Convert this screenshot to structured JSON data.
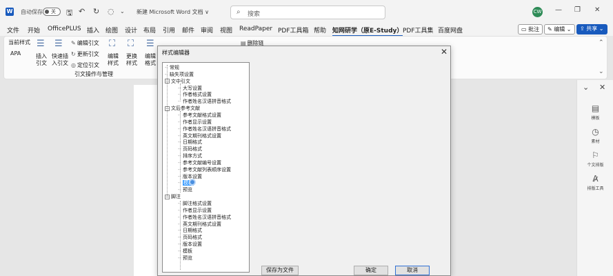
{
  "titlebar": {
    "autosave_label": "自动保存",
    "toggle_state": "关",
    "doc_title": "新建 Microsoft Word 文档 ∨",
    "search_placeholder": "搜索",
    "avatar_initials": "CW",
    "quick_access_icons": [
      "save-icon",
      "undo-icon",
      "redo-icon",
      "customize-icon"
    ]
  },
  "menu": {
    "tabs": [
      "文件",
      "开始",
      "OfficePLUS",
      "插入",
      "绘图",
      "设计",
      "布局",
      "引用",
      "邮件",
      "审阅",
      "视图",
      "ReadPaper",
      "PDF工具箱",
      "帮助",
      "知网研学（原E-Study）",
      "PDF工具集",
      "百度网盘"
    ],
    "active_tab": "知网研学（原E-Study）",
    "comment_button": "批注",
    "edit_button": "编辑",
    "share_button": "共享"
  },
  "ribbon": {
    "current_style_label": "当前样式",
    "current_style_value": "APA",
    "insert_citation": [
      "插入",
      "引文"
    ],
    "quick_insert": [
      "快速插",
      "入引文"
    ],
    "edit_citation": "编辑引文",
    "update_citation": "更新引文",
    "locate_citation": "定位引文",
    "edit_style": [
      "编辑",
      "样式"
    ],
    "change_style": [
      "更换",
      "样式"
    ],
    "edit_format": [
      "编辑",
      "格式"
    ],
    "group_label": "引文操作与管理",
    "delete_link": "删除链"
  },
  "right_pane": {
    "items": [
      "模板",
      "素材",
      "个文排版",
      "排版工具"
    ]
  },
  "dialog": {
    "title": "样式编辑器",
    "tree": [
      {
        "label": "常规",
        "level": 0
      },
      {
        "label": "缺失项设置",
        "level": 0
      },
      {
        "label": "文中引文",
        "level": 0,
        "expander": "−"
      },
      {
        "label": "大写设置",
        "level": 1
      },
      {
        "label": "作者格式设置",
        "level": 1
      },
      {
        "label": "作者姓名汉语拼音格式",
        "level": 1
      },
      {
        "label": "文后参考文献",
        "level": 0,
        "expander": "−"
      },
      {
        "label": "参考文献格式设置",
        "level": 1
      },
      {
        "label": "作者显示设置",
        "level": 1
      },
      {
        "label": "作者姓名汉语拼音格式",
        "level": 1
      },
      {
        "label": "英文期刊格式设置",
        "level": 1
      },
      {
        "label": "日期格式",
        "level": 1
      },
      {
        "label": "页码格式",
        "level": 1
      },
      {
        "label": "排序方式",
        "level": 1
      },
      {
        "label": "参考文献编号设置",
        "level": 1
      },
      {
        "label": "参考文献列表顺序设置",
        "level": 1
      },
      {
        "label": "版本设置",
        "level": 1
      },
      {
        "label": "模板",
        "level": 1,
        "selected": true
      },
      {
        "label": "预览",
        "level": 1
      },
      {
        "label": "脚注",
        "level": 0,
        "expander": "−"
      },
      {
        "label": "脚注格式设置",
        "level": 1
      },
      {
        "label": "作者显示设置",
        "level": 1
      },
      {
        "label": "作者姓名汉语拼音格式",
        "level": 1
      },
      {
        "label": "英文期刊格式设置",
        "level": 1
      },
      {
        "label": "日期格式",
        "level": 1
      },
      {
        "label": "页码格式",
        "level": 1
      },
      {
        "label": "版本设置",
        "level": 1
      },
      {
        "label": "模板",
        "level": 1
      },
      {
        "label": "预览",
        "level": 1
      }
    ],
    "save_as_button": "保存为文件",
    "ok_button": "确定",
    "cancel_button": "取消"
  }
}
